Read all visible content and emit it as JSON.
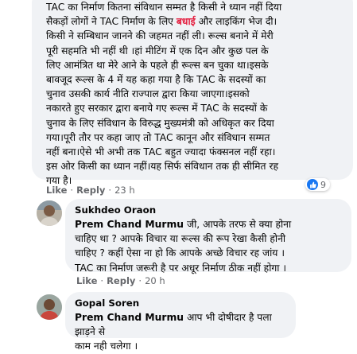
{
  "main_comment": {
    "text_part1": "TAC का निर्माण कितना संविधान सम्मत है किसी ने ध्यान नहीं दिया\nसैकड़ों लोगों ने TAC निर्माण के लिए ",
    "highlight": "बधाई",
    "text_part2": " और लाइकिंग भेज दी।\nकिसी ने सम्बिधान जानने की जहमत नहीं ली। रूल्स बनाने में मेरी\nपूरी सहमति भी नहीं थी ।हां मीटिंग में एक दिन और कुछ पल के\nलिए आमंत्रित था मेरे आने के पहले ही रूल्स बन चुका था।इसके\nबावजूद रूल्स के 4 में यह कहा गया है कि TAC के सदस्यों का\nचुनाव उसकी कार्य नीति राज्पाल द्वारा किया जाएगा।इसको\nनकारते हुए सरकार द्वारा बनाये गए रूल्स में TAC के सदस्यों के\nचुनाव के लिए संविधान के विरुद्ध मुख्यमंत्री को अधिकृत कर दिया\nगया।पूरी तौर पर कहा जाए तो TAC कानून और संविधान सम्मत\nनहीं बना।ऐसे भी अभी तक TAC बहुत ज्यादा फंक्सनल नहीं रहा।\nइस ओर किसी का ध्यान नहीं।यह सिर्फ संविधान तक ही सीमित रह\nगया है।",
    "like_label": "Like",
    "reply_label": "Reply",
    "time": "23 h",
    "reaction_count": "9"
  },
  "replies": [
    {
      "author": "Sukhdeo Oraon",
      "mention": "Prem Chand Murmu",
      "text": " जी, आपके तरफ से क्या होना\nचाहिए था ? आपके विचार या रूल्स की रूप रेखा कैसी होनी\nचाहिए ? कहीं ऐसा ना हो कि आपके अच्छे विचार रह जांय ।\nTAC का निर्माण जरूरी है पर अधूर निर्माण ठीक नहीं होगा ।",
      "like_label": "Like",
      "reply_label": "Reply",
      "time": "20 h"
    },
    {
      "author": "Gopal Soren",
      "mention": "Prem Chand Murmu",
      "text": " आप भी दोषीदार है पला झाड़ने से\nकाम नही चलेगा ।"
    }
  ],
  "separator": "·",
  "colors": {
    "bubble": "#f0f2f5",
    "meta": "#65676b",
    "highlight": "#e41e3f",
    "like_blue": "#1877f2"
  }
}
